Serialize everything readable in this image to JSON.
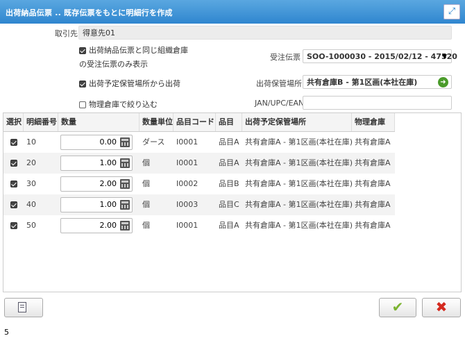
{
  "window": {
    "title": "出荷納品伝票 .. 既存伝票をもとに明細行を作成",
    "expand_icon": "expand-icon"
  },
  "form": {
    "customer_label": "取引先",
    "customer_value": "得意先01",
    "same_org_line1": "出荷納品伝票と同じ組織倉庫",
    "same_org_line2": "の受注伝票のみ表示",
    "same_org_checked": true,
    "order_label": "受注伝票",
    "order_value": "SOO-1000030 - 2015/02/12 - 47520",
    "ship_from_planned_label": "出荷予定保管場所から出荷",
    "ship_from_planned_checked": true,
    "location_label": "出荷保管場所",
    "location_value": "共有倉庫B - 第1区画(本社在庫)",
    "filter_physical_label": "物理倉庫で絞り込む",
    "filter_physical_checked": false,
    "jan_label": "JAN/UPC/EAN",
    "jan_value": ""
  },
  "grid": {
    "columns": [
      "選択",
      "明細番号",
      "数量",
      "数量単位",
      "品目コード",
      "品目",
      "出荷予定保管場所",
      "物理倉庫"
    ],
    "rows": [
      {
        "selected": true,
        "line": "10",
        "qty": "0.00",
        "uom": "ダース",
        "code": "I0001",
        "item": "品目A",
        "location": "共有倉庫A - 第1区画(本社在庫)",
        "warehouse": "共有倉庫A"
      },
      {
        "selected": true,
        "line": "20",
        "qty": "1.00",
        "uom": "個",
        "code": "I0001",
        "item": "品目A",
        "location": "共有倉庫A - 第1区画(本社在庫)",
        "warehouse": "共有倉庫A"
      },
      {
        "selected": true,
        "line": "30",
        "qty": "2.00",
        "uom": "個",
        "code": "I0002",
        "item": "品目B",
        "location": "共有倉庫A - 第1区画(本社在庫)",
        "warehouse": "共有倉庫A"
      },
      {
        "selected": true,
        "line": "40",
        "qty": "1.00",
        "uom": "個",
        "code": "I0003",
        "item": "品目C",
        "location": "共有倉庫A - 第1区画(本社在庫)",
        "warehouse": "共有倉庫A"
      },
      {
        "selected": true,
        "line": "50",
        "qty": "2.00",
        "uom": "個",
        "code": "I0001",
        "item": "品目A",
        "location": "共有倉庫A - 第1区画(本社在庫)",
        "warehouse": "共有倉庫A"
      }
    ]
  },
  "footer": {
    "count": "5",
    "ok_color": "#7cb431",
    "cancel_color": "#d42a1f"
  }
}
